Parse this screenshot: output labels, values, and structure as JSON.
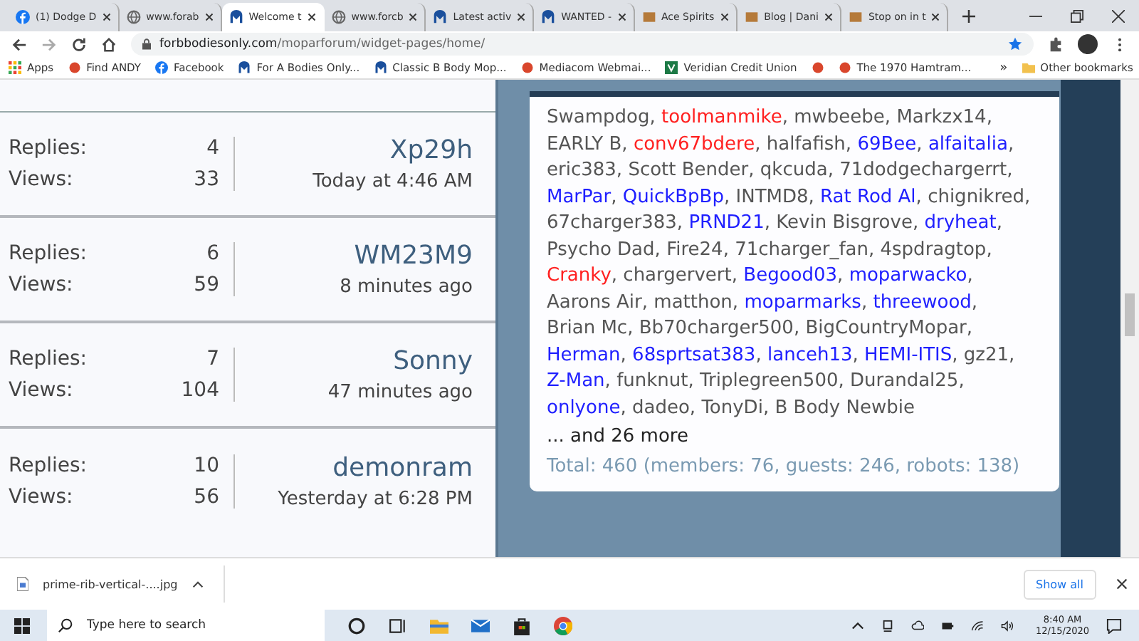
{
  "tabs": [
    {
      "title": "(1) Dodge D",
      "kind": "facebook",
      "selected": false
    },
    {
      "title": "www.forab",
      "kind": "globe",
      "selected": false
    },
    {
      "title": "Welcome t",
      "kind": "mopar",
      "selected": true
    },
    {
      "title": "www.forcb",
      "kind": "globe",
      "selected": false
    },
    {
      "title": "Latest activ",
      "kind": "mopar",
      "selected": false
    },
    {
      "title": "WANTED -",
      "kind": "mopar",
      "selected": false
    },
    {
      "title": "Ace Spirits",
      "kind": "image",
      "selected": false
    },
    {
      "title": "Blog | Dani",
      "kind": "image",
      "selected": false
    },
    {
      "title": "Stop on in t",
      "kind": "image",
      "selected": false
    }
  ],
  "address": {
    "host": "forbbodiesonly.com",
    "path": "/moparforum/widget-pages/home/"
  },
  "bookmarks": [
    {
      "label": "Apps",
      "kind": "apps"
    },
    {
      "label": "Find ANDY",
      "kind": "image"
    },
    {
      "label": "Facebook",
      "kind": "facebook"
    },
    {
      "label": "For A Bodies Only...",
      "kind": "mopar"
    },
    {
      "label": "Classic B Body Mop...",
      "kind": "mopar"
    },
    {
      "label": "Mediacom Webmai...",
      "kind": "image"
    },
    {
      "label": "Veridian Credit Union",
      "kind": "bank"
    },
    {
      "kind": "image"
    },
    {
      "label": "The 1970 Hamtram...",
      "kind": "image"
    }
  ],
  "bookmarks_overflow": "»",
  "other_bookmarks": "Other bookmarks",
  "threads": [
    {
      "replies_label": "Replies:",
      "replies": "4",
      "views_label": "Views:",
      "views": "33",
      "last_poster": "Xp29h",
      "last_time": "Today at 4:46 AM"
    },
    {
      "replies_label": "Replies:",
      "replies": "6",
      "views_label": "Views:",
      "views": "59",
      "last_poster": "WM23M9",
      "last_time": "8 minutes ago"
    },
    {
      "replies_label": "Replies:",
      "replies": "7",
      "views_label": "Views:",
      "views": "104",
      "last_poster": "Sonny",
      "last_time": "47 minutes ago"
    },
    {
      "replies_label": "Replies:",
      "replies": "10",
      "views_label": "Views:",
      "views": "56",
      "last_poster": "demonram",
      "last_time": "Yesterday at 6:28 PM"
    }
  ],
  "online_members": [
    {
      "name": "Swampdog",
      "color": "#555555"
    },
    {
      "name": "toolmanmike",
      "color": "#ff2020"
    },
    {
      "name": "mwbeebe",
      "color": "#555555"
    },
    {
      "name": "Markzx14",
      "color": "#555555"
    },
    {
      "name": "EARLY B",
      "color": "#555555"
    },
    {
      "name": "conv67bdere",
      "color": "#ff2020"
    },
    {
      "name": "halfafish",
      "color": "#555555"
    },
    {
      "name": "69Bee",
      "color": "#2020ff"
    },
    {
      "name": "alfaitalia",
      "color": "#2020ff"
    },
    {
      "name": "eric383",
      "color": "#555555"
    },
    {
      "name": "Scott Bender",
      "color": "#555555"
    },
    {
      "name": "qkcuda",
      "color": "#555555"
    },
    {
      "name": "71dodgechargerrt",
      "color": "#555555"
    },
    {
      "name": "MarPar",
      "color": "#2020ff"
    },
    {
      "name": "QuickBpBp",
      "color": "#2020ff"
    },
    {
      "name": "INTMD8",
      "color": "#555555"
    },
    {
      "name": "Rat Rod Al",
      "color": "#2020ff"
    },
    {
      "name": "chignikred",
      "color": "#555555"
    },
    {
      "name": "67charger383",
      "color": "#555555"
    },
    {
      "name": "PRND21",
      "color": "#2020ff"
    },
    {
      "name": "Kevin Bisgrove",
      "color": "#555555"
    },
    {
      "name": "dryheat",
      "color": "#2020ff"
    },
    {
      "name": "Psycho Dad",
      "color": "#555555"
    },
    {
      "name": "Fire24",
      "color": "#555555"
    },
    {
      "name": "71charger_fan",
      "color": "#555555"
    },
    {
      "name": "4spdragtop",
      "color": "#555555"
    },
    {
      "name": "Cranky",
      "color": "#ff2020"
    },
    {
      "name": "chargervert",
      "color": "#555555"
    },
    {
      "name": "Begood03",
      "color": "#2020ff"
    },
    {
      "name": "moparwacko",
      "color": "#2020ff"
    },
    {
      "name": "Aarons Air",
      "color": "#555555"
    },
    {
      "name": "matthon",
      "color": "#555555"
    },
    {
      "name": "moparmarks",
      "color": "#2020ff"
    },
    {
      "name": "threewood",
      "color": "#2020ff"
    },
    {
      "name": "Brian Mc",
      "color": "#555555"
    },
    {
      "name": "Bb70charger500",
      "color": "#555555"
    },
    {
      "name": "BigCountryMopar",
      "color": "#555555"
    },
    {
      "name": "Herman",
      "color": "#2020ff"
    },
    {
      "name": "68sprtsat383",
      "color": "#2020ff"
    },
    {
      "name": "lanceh13",
      "color": "#2020ff"
    },
    {
      "name": "HEMI-ITIS",
      "color": "#2020ff"
    },
    {
      "name": "gz21",
      "color": "#555555"
    },
    {
      "name": "Z-Man",
      "color": "#2020ff"
    },
    {
      "name": "funknut",
      "color": "#555555"
    },
    {
      "name": "Triplegreen500",
      "color": "#555555"
    },
    {
      "name": "Durandal25",
      "color": "#555555"
    },
    {
      "name": "onlyone",
      "color": "#2020ff"
    },
    {
      "name": "dadeo",
      "color": "#555555"
    },
    {
      "name": "TonyDi",
      "color": "#555555"
    },
    {
      "name": "B Body Newbie",
      "color": "#555555"
    }
  ],
  "separator": ",",
  "more_link": "... and 26 more",
  "total": "Total: 460 (members: 76, guests: 246, robots: 138)",
  "download": {
    "file": "prime-rib-vertical-....jpg",
    "show_all": "Show all"
  },
  "taskbar": {
    "search_placeholder": "Type here to search",
    "time": "8:40 AM",
    "date": "12/15/2020"
  }
}
